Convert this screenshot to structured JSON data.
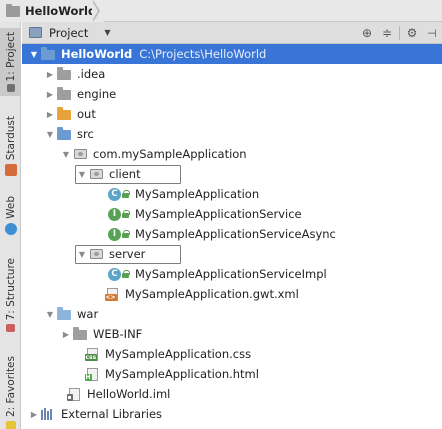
{
  "breadcrumb": {
    "project": "HelloWorld"
  },
  "left_stripe": {
    "buttons": [
      {
        "label": "1: Project",
        "active": true
      },
      {
        "label": "Stardust",
        "active": false
      },
      {
        "label": "Web",
        "active": false
      },
      {
        "label": "7: Structure",
        "active": false
      },
      {
        "label": "2: Favorites",
        "active": false
      }
    ]
  },
  "tool_window": {
    "title": "Project",
    "dropdown_icon": "triangle-down",
    "actions": [
      "target-icon",
      "collapse-icon",
      "gear-icon",
      "hide-icon"
    ]
  },
  "tree": {
    "rows": [
      {
        "label": "HelloWorld",
        "path": "C:\\Projects\\HelloWorld",
        "icon": "folder-blue",
        "expanded": true,
        "selected": true,
        "bold": true
      },
      {
        "label": ".idea",
        "icon": "folder-gray",
        "expanded": false
      },
      {
        "label": "engine",
        "icon": "folder-gray",
        "expanded": false
      },
      {
        "label": "out",
        "icon": "folder-orange",
        "expanded": false
      },
      {
        "label": "src",
        "icon": "folder-blue",
        "expanded": true
      },
      {
        "label": "com.mySampleApplication",
        "icon": "package",
        "expanded": true
      },
      {
        "label": "client",
        "icon": "package",
        "expanded": true
      },
      {
        "label": "MySampleApplication",
        "icon": "class"
      },
      {
        "label": "MySampleApplicationService",
        "icon": "interface"
      },
      {
        "label": "MySampleApplicationServiceAsync",
        "icon": "interface"
      },
      {
        "label": "server",
        "icon": "package",
        "expanded": true
      },
      {
        "label": "MySampleApplicationServiceImpl",
        "icon": "class"
      },
      {
        "label": "MySampleApplication.gwt.xml",
        "icon": "file-xml"
      },
      {
        "label": "war",
        "icon": "folder-lightblue",
        "expanded": true
      },
      {
        "label": "WEB-INF",
        "icon": "folder-gray",
        "expanded": false
      },
      {
        "label": "MySampleApplication.css",
        "icon": "file-css"
      },
      {
        "label": "MySampleApplication.html",
        "icon": "file-html"
      },
      {
        "label": "HelloWorld.iml",
        "icon": "file-iml"
      },
      {
        "label": "External Libraries",
        "icon": "libraries",
        "expanded": false
      }
    ]
  },
  "colors": {
    "selection": "#3875d6",
    "class_badge": "#5aa5c8",
    "interface_badge": "#56a356",
    "folder_orange": "#e9a23b",
    "folder_blue": "#6c9bd2"
  }
}
